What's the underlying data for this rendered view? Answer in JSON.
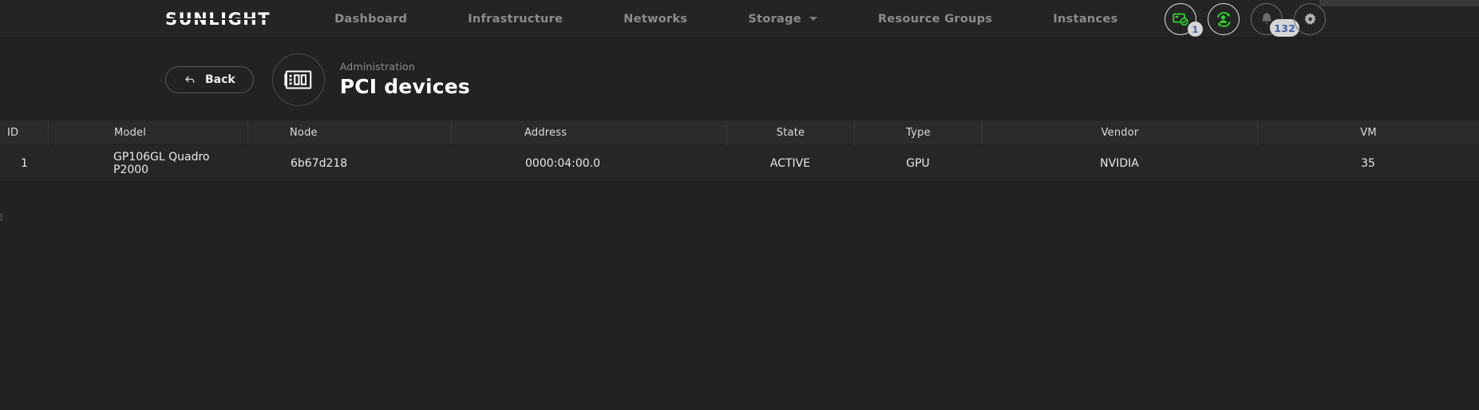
{
  "brand": {
    "name": "SUNLIGHT"
  },
  "nav": {
    "items": [
      {
        "label": "Dashboard",
        "has_caret": false
      },
      {
        "label": "Infrastructure",
        "has_caret": false
      },
      {
        "label": "Networks",
        "has_caret": false
      },
      {
        "label": "Storage",
        "has_caret": true
      },
      {
        "label": "Resource Groups",
        "has_caret": false
      },
      {
        "label": "Instances",
        "has_caret": false
      }
    ]
  },
  "actions": {
    "items": [
      {
        "icon": "server-check-icon",
        "badge": "1",
        "accent": "#2fd62f",
        "active": true
      },
      {
        "icon": "user-sync-icon",
        "badge": "",
        "accent": "#2fd62f",
        "active": true
      },
      {
        "icon": "bell-icon",
        "badge": "132",
        "accent": "#6e6e6e",
        "active": false
      },
      {
        "icon": "gear-icon",
        "badge": "",
        "accent": "#b4b4b4",
        "active": false
      }
    ]
  },
  "header": {
    "back_label": "Back",
    "back_icon": "back-arrow-icon",
    "page_icon": "pci-card-icon",
    "eyebrow": "Administration",
    "title": "PCI devices"
  },
  "table": {
    "columns": [
      "ID",
      "Model",
      "Node",
      "Address",
      "State",
      "Type",
      "Vendor",
      "VM"
    ],
    "rows": [
      {
        "id": "1",
        "model": "GP106GL Quadro P2000",
        "node": "6b67d218",
        "address": "0000:04:00.0",
        "state": "ACTIVE",
        "type": "GPU",
        "vendor": "NVIDIA",
        "vm": "35"
      }
    ]
  },
  "colors": {
    "page_bg": "#222222",
    "topbar_bg": "#242424",
    "header_row_bg": "#2b2b2b",
    "row_bg": "#262626",
    "accent_green": "#2fd62f",
    "badge_bg": "#d6d6d6",
    "badge_text": "#3f5fa8",
    "nav_text": "#8d8d8d"
  }
}
